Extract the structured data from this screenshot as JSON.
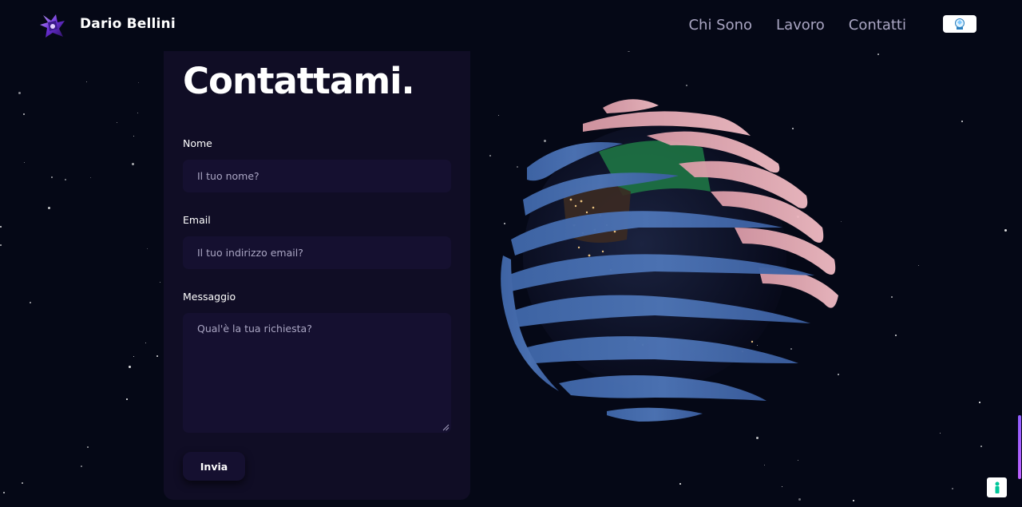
{
  "navbar": {
    "brand": "Dario Bellini",
    "links": [
      "Chi Sono",
      "Lavoro",
      "Contatti"
    ],
    "language_flag_icon": "avatar-flag-icon"
  },
  "contact": {
    "title": "Contattami.",
    "name_label": "Nome",
    "name_placeholder": "Il tuo nome?",
    "email_label": "Email",
    "email_placeholder": "Il tuo indirizzo email?",
    "message_label": "Messaggio",
    "message_placeholder": "Qual'è la tua richiesta?",
    "submit_label": "Invia"
  },
  "colors": {
    "background": "#050816",
    "card": "#100d25",
    "input": "#151030",
    "nav_text": "#aaa6c3",
    "accent": "#915eff",
    "help_icon": "#00c79a"
  },
  "icons": {
    "logo": "logo-icon",
    "help": "accessibility-icon"
  }
}
